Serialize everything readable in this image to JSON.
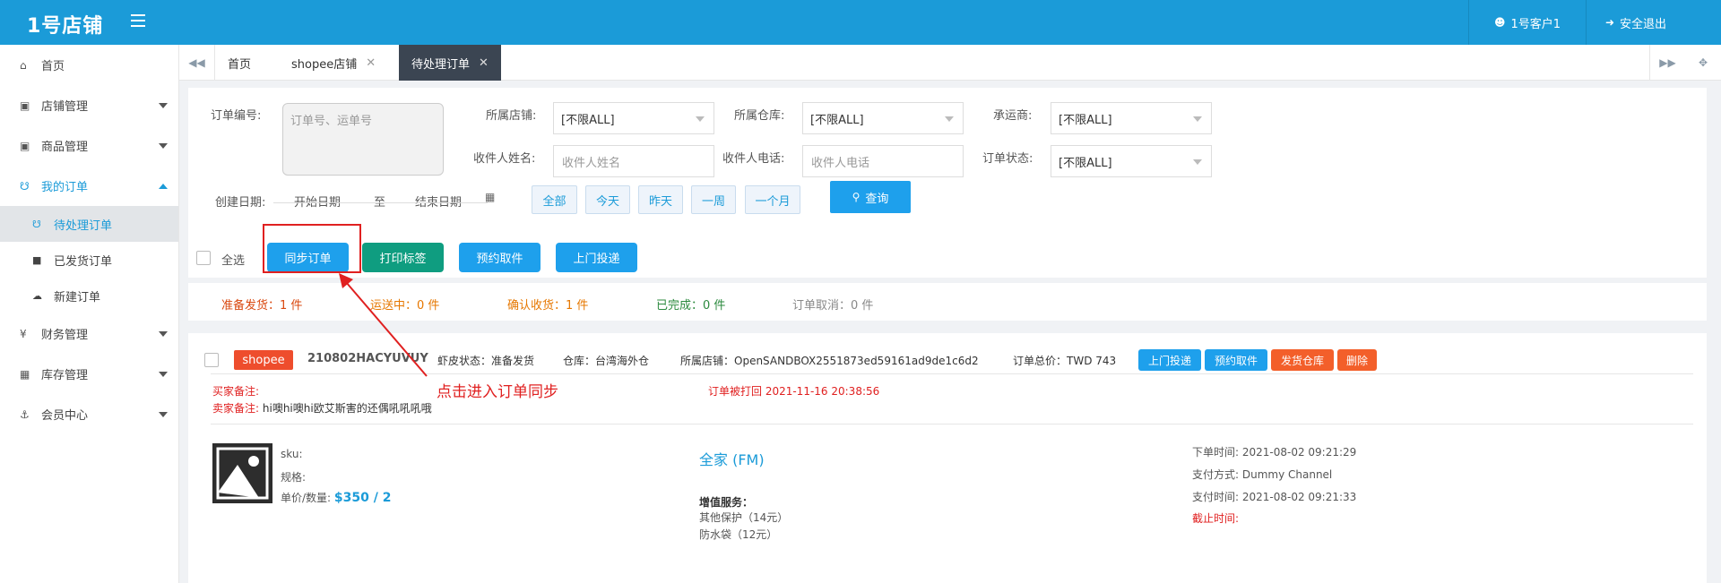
{
  "header": {
    "logo": "1号店铺",
    "user": "1号客户1",
    "logout": "安全退出"
  },
  "sidebar": {
    "items": [
      {
        "label": "首页"
      },
      {
        "label": "店铺管理"
      },
      {
        "label": "商品管理"
      },
      {
        "label": "我的订单"
      },
      {
        "label": "待处理订单"
      },
      {
        "label": "已发货订单"
      },
      {
        "label": "新建订单"
      },
      {
        "label": "财务管理"
      },
      {
        "label": "库存管理"
      },
      {
        "label": "会员中心"
      }
    ]
  },
  "tabs": [
    {
      "label": "首页"
    },
    {
      "label": "shopee店铺",
      "close": "✕"
    },
    {
      "label": "待处理订单",
      "close": "✕"
    }
  ],
  "filters": {
    "order_no_label": "订单编号:",
    "order_no_placeholder": "订单号、运单号",
    "store_label": "所属店铺:",
    "store_value": "[不限ALL]",
    "warehouse_label": "所属仓库:",
    "warehouse_value": "[不限ALL]",
    "carrier_label": "承运商:",
    "carrier_value": "[不限ALL]",
    "recipient_name_label": "收件人姓名:",
    "recipient_name_placeholder": "收件人姓名",
    "recipient_phone_label": "收件人电话:",
    "recipient_phone_placeholder": "收件人电话",
    "order_status_label": "订单状态:",
    "order_status_value": "[不限ALL]",
    "create_date_label": "创建日期:",
    "start_date": "开始日期",
    "to": "至",
    "end_date": "结束日期",
    "quick_dates": [
      "全部",
      "今天",
      "昨天",
      "一周",
      "一个月"
    ],
    "search": "查询",
    "select_all": "全选",
    "actions": [
      "同步订单",
      "打印标签",
      "预约取件",
      "上门投递"
    ]
  },
  "annotation": "点击进入订单同步",
  "status_counts": [
    {
      "text": "准备发货：1 件",
      "color": "#d9480f"
    },
    {
      "text": "运送中：0 件",
      "color": "#e67700"
    },
    {
      "text": "确认收货：1 件",
      "color": "#e67700"
    },
    {
      "text": "已完成：0 件",
      "color": "#2b8a3e"
    },
    {
      "text": "订单取消：0 件",
      "color": "#888888"
    }
  ],
  "order": {
    "platform": "shopee",
    "order_no": "210802HACYUVUY",
    "shopee_status": "虾皮状态：准备发货",
    "warehouse": "仓库：台湾海外仓",
    "store": "所属店铺：OpenSANDBOX2551873ed59161ad9de1c6d2",
    "total": "订单总价：TWD 743",
    "buttons": [
      "上门投递",
      "预约取件",
      "发货仓库",
      "删除"
    ],
    "buyer_note_label": "买家备注:",
    "seller_note_label": "卖家备注:",
    "seller_note": "hi噢hi噢hi欧艾斯害的还偶吼吼吼哦",
    "returned": "订单被打回 2021-11-16 20:38:56",
    "sku_label": "sku:",
    "spec_label": "规格:",
    "price_label": "单价/数量:",
    "price": "$350 / 2",
    "shipping": "全家 (FM)",
    "value_added_label": "增值服务：",
    "services": [
      "其他保护（14元）",
      "防水袋（12元）"
    ],
    "order_time": "下单时间:  2021-08-02 09:21:29",
    "pay_method": "支付方式:  Dummy Channel",
    "pay_time": "支付时间:  2021-08-02 09:21:33",
    "deadline": "截止时间:"
  },
  "colors": {
    "topbar": "#1b9bd8",
    "primary": "#1ea0ec",
    "print_green": "#0f9d80",
    "shopee": "#ee4d2d",
    "annotation_red": "#e02020"
  }
}
